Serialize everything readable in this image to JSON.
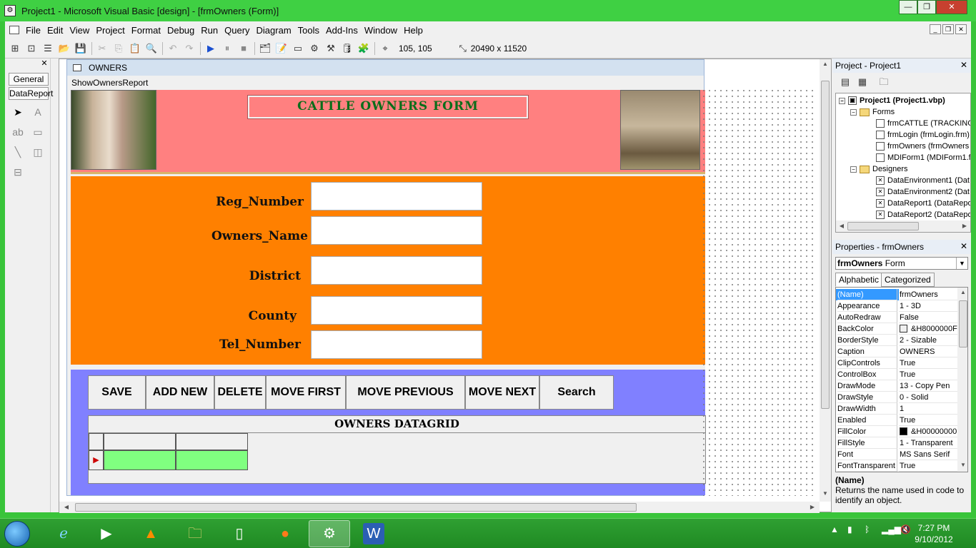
{
  "window": {
    "title": "Project1 - Microsoft Visual Basic [design] - [frmOwners (Form)]",
    "controls": [
      "—",
      "❐",
      "✕"
    ]
  },
  "menu": [
    "File",
    "Edit",
    "View",
    "Project",
    "Format",
    "Debug",
    "Run",
    "Query",
    "Diagram",
    "Tools",
    "Add-Ins",
    "Window",
    "Help"
  ],
  "toolbar": {
    "position": "105, 105",
    "size": "20490 x 11520"
  },
  "toolbox": {
    "tabs": [
      "General",
      "DataReport"
    ]
  },
  "form": {
    "window_title": "OWNERS",
    "menu_item": "ShowOwnersReport",
    "caption": "CATTLE OWNERS FORM",
    "fields": [
      "Reg_Number",
      "Owners_Name",
      "District",
      "County",
      "Tel_Number"
    ],
    "buttons": [
      "SAVE",
      "ADD NEW",
      "DELETE",
      "MOVE FIRST",
      "MOVE PREVIOUS",
      "MOVE NEXT",
      "Search"
    ],
    "grid_caption": "OWNERS DATAGRID"
  },
  "project": {
    "title": "Project - Project1",
    "root": "Project1 (Project1.vbp)",
    "folders": [
      "Forms",
      "Designers"
    ],
    "forms": [
      "frmCATTLE (TRACKING",
      "frmLogin (frmLogin.frm)",
      "frmOwners (frmOwners",
      "MDIForm1 (MDIForm1.f"
    ],
    "designers": [
      "DataEnvironment1 (Dat",
      "DataEnvironment2 (Dat",
      "DataReport1 (DataRepo",
      "DataReport2 (DataRepo"
    ]
  },
  "properties": {
    "title": "Properties - frmOwners",
    "object_name": "frmOwners",
    "object_type": "Form",
    "tabs": [
      "Alphabetic",
      "Categorized"
    ],
    "rows": [
      {
        "name": "(Name)",
        "value": "frmOwners"
      },
      {
        "name": "Appearance",
        "value": "1 - 3D"
      },
      {
        "name": "AutoRedraw",
        "value": "False"
      },
      {
        "name": "BackColor",
        "value": "&H8000000F"
      },
      {
        "name": "BorderStyle",
        "value": "2 - Sizable"
      },
      {
        "name": "Caption",
        "value": "OWNERS"
      },
      {
        "name": "ClipControls",
        "value": "True"
      },
      {
        "name": "ControlBox",
        "value": "True"
      },
      {
        "name": "DrawMode",
        "value": "13 - Copy Pen"
      },
      {
        "name": "DrawStyle",
        "value": "0 - Solid"
      },
      {
        "name": "DrawWidth",
        "value": "1"
      },
      {
        "name": "Enabled",
        "value": "True"
      },
      {
        "name": "FillColor",
        "value": "&H00000000"
      },
      {
        "name": "FillStyle",
        "value": "1 - Transparent"
      },
      {
        "name": "Font",
        "value": "MS Sans Serif"
      },
      {
        "name": "FontTransparent",
        "value": "True"
      }
    ],
    "desc_title": "(Name)",
    "desc_text": "Returns the name used in code to identify an object."
  },
  "taskbar": {
    "time": "7:27 PM",
    "date": "9/10/2012"
  },
  "colors": {
    "header_bg": "#ff8080",
    "fields_bg": "#ff8000",
    "buttons_bg": "#8080ff",
    "grid_cell": "#80ff80",
    "caption_text": "#0a6d1a"
  }
}
